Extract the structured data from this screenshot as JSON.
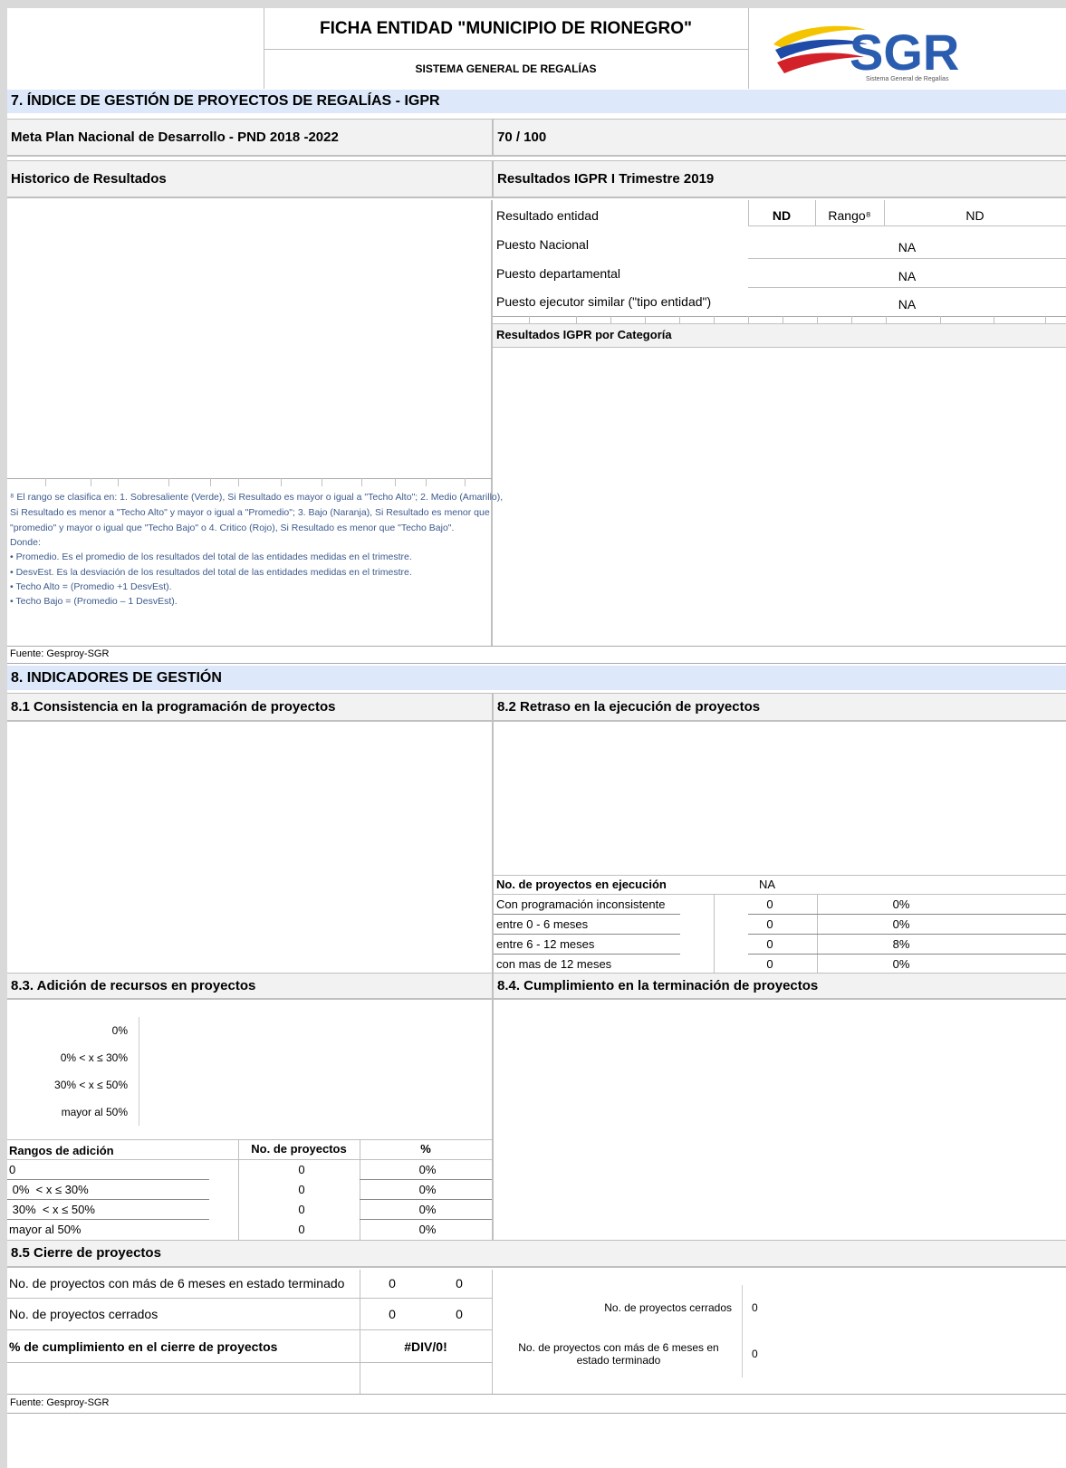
{
  "header": {
    "title": "FICHA ENTIDAD \"MUNICIPIO DE RIONEGRO\"",
    "subtitle": "SISTEMA GENERAL DE REGALÍAS",
    "logo_text": "SGR",
    "logo_tagline": "Sistema General de Regalías"
  },
  "section7": {
    "title": "7. ÍNDICE DE GESTIÓN DE PROYECTOS DE REGALÍAS - IGPR",
    "meta_label": "Meta Plan Nacional de Desarrollo - PND 2018 -2022",
    "meta_value": "70 / 100",
    "historico_label": "Historico de Resultados",
    "resultados_label": "Resultados IGPR I Trimestre 2019",
    "resultado_entidad_label": "Resultado entidad",
    "resultado_entidad_value": "ND",
    "rango_label": "Rango⁸",
    "rango_value": "ND",
    "puesto_nacional_label": "Puesto Nacional",
    "puesto_nacional_value": "NA",
    "puesto_departamental_label": "Puesto departamental",
    "puesto_departamental_value": "NA",
    "puesto_similar_label": "Puesto ejecutor similar (\"tipo entidad\")",
    "puesto_similar_value": "NA",
    "categoria_label": "Resultados IGPR por Categoría",
    "notes": [
      "⁸ El rango se clasifica en: 1. Sobresaliente (Verde), Si Resultado es mayor o igual a \"Techo Alto\"; 2. Medio (Amarillo),",
      "Si Resultado es menor a \"Techo Alto\" y mayor o igual a \"Promedio\"; 3. Bajo (Naranja), Si Resultado es menor que",
      "\"promedio\" y mayor o igual que \"Techo Bajo\" o 4. Critico (Rojo), Si Resultado es menor que \"Techo Bajo\".",
      "Donde:",
      "• Promedio. Es el promedio de los resultados del total de las entidades medidas en el trimestre.",
      "• DesvEst. Es la desviación de los resultados del total de las entidades medidas en el trimestre.",
      "• Techo Alto = (Promedio +1 DesvEst).",
      "• Techo Bajo = (Promedio – 1 DesvEst)."
    ],
    "fuente": "Fuente: Gesproy-SGR"
  },
  "section8": {
    "title": "8. INDICADORES DE GESTIÓN",
    "s81_label": "8.1 Consistencia en la programación de proyectos",
    "s82_label": "8.2 Retraso en la ejecución de proyectos",
    "s82_table": {
      "header_label": "No. de proyectos en ejecución",
      "header_value": "NA",
      "rows": [
        {
          "label": "Con programación inconsistente",
          "count": "0",
          "pct": "0%"
        },
        {
          "label": "entre 0 - 6 meses",
          "count": "0",
          "pct": "0%"
        },
        {
          "label": "entre 6 - 12 meses",
          "count": "0",
          "pct": "8%"
        },
        {
          "label": "con mas de 12 meses",
          "count": "0",
          "pct": "0%"
        }
      ]
    },
    "s83_label": "8.3. Adición de recursos en proyectos",
    "s83_chart_labels": [
      "0%",
      "0%  < x ≤ 30%",
      "30%  < x ≤ 50%",
      "mayor al 50%"
    ],
    "s83_table": {
      "col_range": "Rangos de adición",
      "col_count": "No. de proyectos",
      "col_pct": "%",
      "rows": [
        {
          "label": "0",
          "count": "0",
          "pct": "0%"
        },
        {
          "label": " 0%  < x ≤ 30%",
          "count": "0",
          "pct": "0%"
        },
        {
          "label": " 30%  < x ≤ 50%",
          "count": "0",
          "pct": "0%"
        },
        {
          "label": "mayor al 50%",
          "count": "0",
          "pct": "0%"
        }
      ]
    },
    "s84_label": "8.4. Cumplimiento en la terminación de proyectos",
    "s85_label": "8.5 Cierre de proyectos",
    "s85_rows": [
      {
        "label": "No. de proyectos con más de 6 meses en estado terminado",
        "v1": "0",
        "v2": "0"
      },
      {
        "label": "No. de proyectos cerrados",
        "v1": "0",
        "v2": "0"
      }
    ],
    "s85_pct_label": "% de cumplimiento en el cierre de proyectos",
    "s85_pct_value": "#DIV/0!",
    "s85_chart": [
      {
        "label": "No. de proyectos cerrados",
        "value": "0"
      },
      {
        "label": "No. de proyectos con más de 6 meses en estado terminado",
        "value": "0"
      }
    ],
    "fuente": "Fuente: Gesproy-SGR"
  }
}
